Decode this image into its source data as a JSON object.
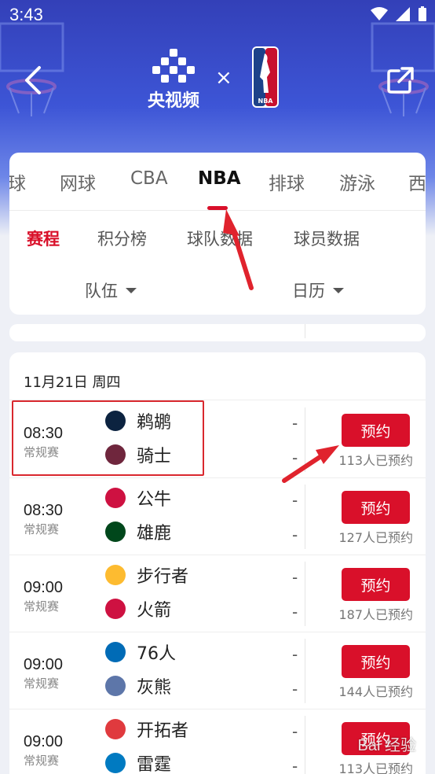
{
  "status_bar": {
    "time": "3:43"
  },
  "header": {
    "brand_name": "央视频",
    "times_symbol": "×",
    "nba_logo_text": "NBA"
  },
  "sports_tabs": [
    {
      "label": "球",
      "active": false
    },
    {
      "label": "网球",
      "active": false
    },
    {
      "label": "CBA",
      "active": false
    },
    {
      "label": "NBA",
      "active": true
    },
    {
      "label": "排球",
      "active": false
    },
    {
      "label": "游泳",
      "active": false
    },
    {
      "label": "西",
      "active": false
    }
  ],
  "sub_tabs": [
    {
      "label": "赛程",
      "active": true
    },
    {
      "label": "积分榜",
      "active": false
    },
    {
      "label": "球队数据",
      "active": false
    },
    {
      "label": "球员数据",
      "active": false
    }
  ],
  "filters": [
    {
      "label": "队伍"
    },
    {
      "label": "日历"
    }
  ],
  "date_header": "11月21日 周四",
  "matches": [
    {
      "time": "08:30",
      "type": "常规赛",
      "home": "鹈鹕",
      "away": "骑士",
      "home_score": "-",
      "away_score": "-",
      "button": "预约",
      "count": "113人已预约"
    },
    {
      "time": "08:30",
      "type": "常规赛",
      "home": "公牛",
      "away": "雄鹿",
      "home_score": "-",
      "away_score": "-",
      "button": "预约",
      "count": "127人已预约"
    },
    {
      "time": "09:00",
      "type": "常规赛",
      "home": "步行者",
      "away": "火箭",
      "home_score": "-",
      "away_score": "-",
      "button": "预约",
      "count": "187人已预约"
    },
    {
      "time": "09:00",
      "type": "常规赛",
      "home": "76人",
      "away": "灰熊",
      "home_score": "-",
      "away_score": "-",
      "button": "预约",
      "count": "144人已预约"
    },
    {
      "time": "09:00",
      "type": "常规赛",
      "home": "开拓者",
      "away": "雷霆",
      "home_score": "-",
      "away_score": "-",
      "button": "预约",
      "count": "113人已预约"
    }
  ],
  "team_logos": [
    {
      "home_color": "#0c2340",
      "away_color": "#6f263d"
    },
    {
      "home_color": "#ce1141",
      "away_color": "#00471b"
    },
    {
      "home_color": "#fdbb30",
      "away_color": "#ce1141"
    },
    {
      "home_color": "#006bb6",
      "away_color": "#5d76a9"
    },
    {
      "home_color": "#e03a3e",
      "away_color": "#007ac1"
    }
  ],
  "colors": {
    "accent": "#d9102a",
    "header_blue": "#3d55d6"
  },
  "watermark": "Bai 经验"
}
